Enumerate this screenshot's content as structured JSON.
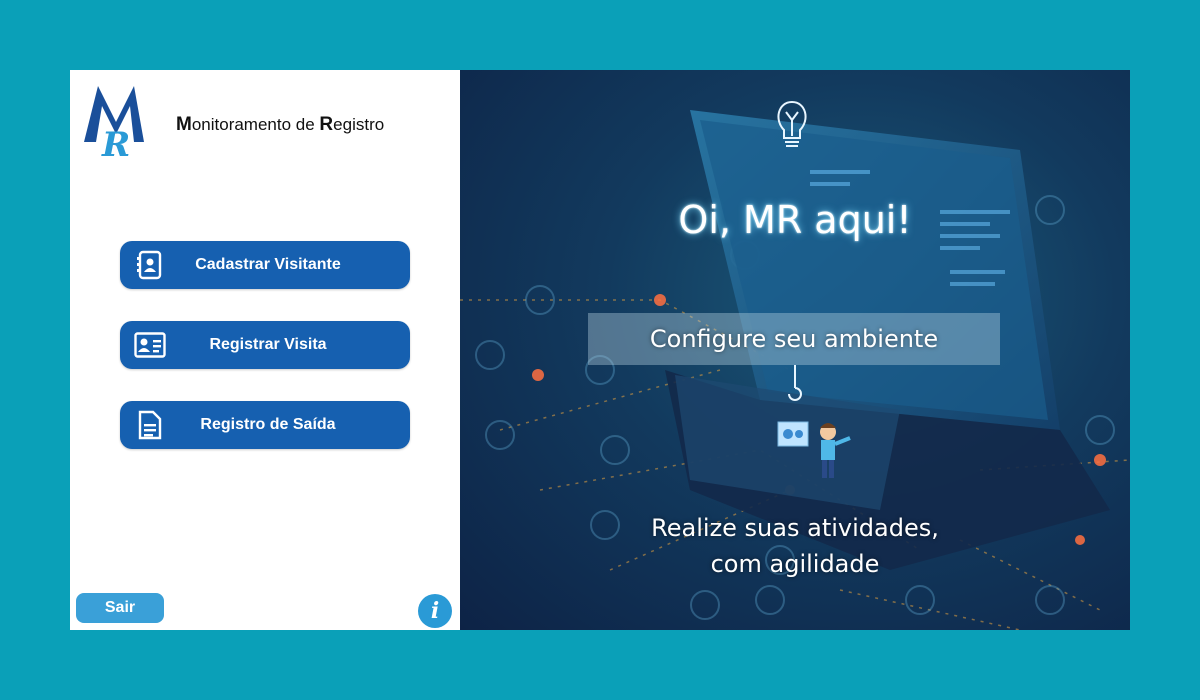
{
  "app": {
    "title_initial_1": "M",
    "title_word_1": "onitoramento de ",
    "title_initial_2": "R",
    "title_word_2": "egistro",
    "logo_text": "MR"
  },
  "menu": {
    "items": [
      {
        "label": "Cadastrar Visitante",
        "icon": "contact-book-icon"
      },
      {
        "label": "Registrar Visita",
        "icon": "id-card-icon"
      },
      {
        "label": "Registro de Saída",
        "icon": "document-icon"
      }
    ]
  },
  "footer": {
    "exit_label": "Sair",
    "info_label": "i"
  },
  "hero": {
    "greeting": "Oi, MR aqui!",
    "config_label": "Configure seu ambiente",
    "tagline_line1": "Realize suas atividades,",
    "tagline_line2": "com agilidade"
  },
  "colors": {
    "page_bg": "#0aa0b8",
    "button_blue": "#1660b0",
    "exit_blue": "#3aa0d8"
  }
}
